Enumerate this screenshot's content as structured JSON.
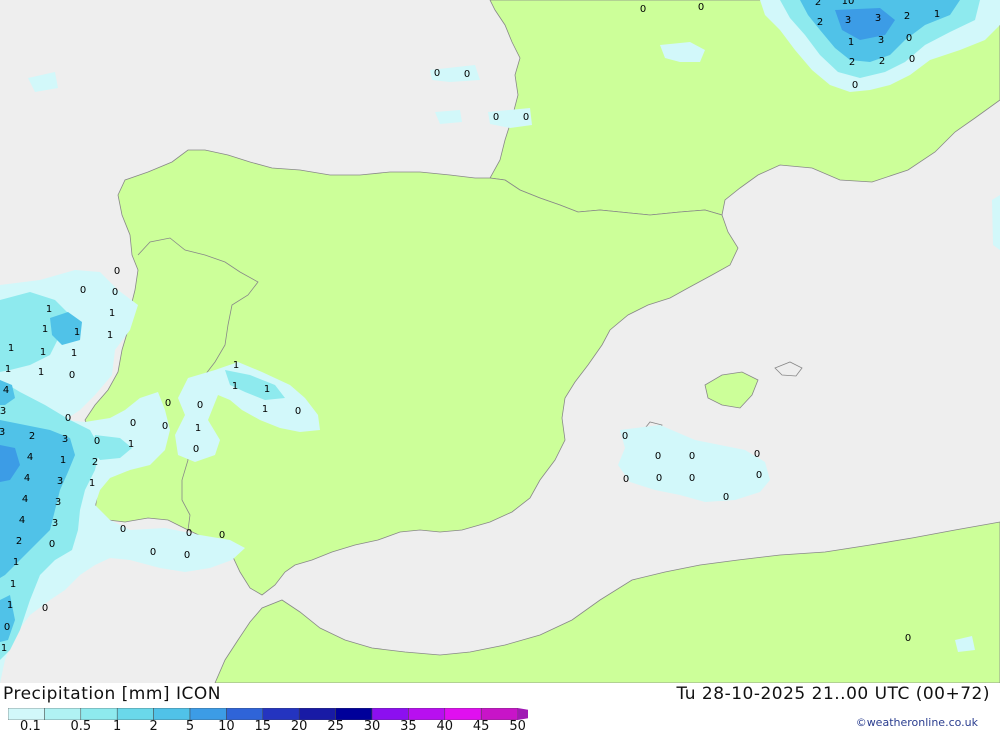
{
  "map": {
    "region": "Iberian Peninsula",
    "colors": {
      "sea": "#eeeeee",
      "land": "#ccff99",
      "border": "#888888"
    }
  },
  "legend": {
    "title": "Precipitation [mm]",
    "model": "ICON",
    "values": [
      "0.1",
      "0.5",
      "1",
      "2",
      "5",
      "10",
      "15",
      "20",
      "25",
      "30",
      "35",
      "40",
      "45",
      "50"
    ],
    "colors": [
      "#d2f8fa",
      "#b0f2f3",
      "#8eeaee",
      "#6ad8ea",
      "#50c2e8",
      "#3c9ce6",
      "#2f64d8",
      "#2434c0",
      "#181aa5",
      "#00009a",
      "#8c0ff0",
      "#b80ff0",
      "#e00ff0",
      "#c814c8",
      "#a019b4"
    ]
  },
  "timestamp": "Tu 28-10-2025 21..00 UTC (00+72)",
  "credit": "©weatheronline.co.uk",
  "labels": [
    "0",
    "0",
    "2",
    "10",
    "2",
    "3",
    "3",
    "2",
    "1",
    "1",
    "3",
    "0",
    "2",
    "2",
    "0",
    "0",
    "0",
    "0",
    "0",
    "0",
    "0",
    "0",
    "0",
    "1",
    "1",
    "1",
    "1",
    "1",
    "1",
    "1",
    "1",
    "1",
    "1",
    "0",
    "4",
    "3",
    "0",
    "3",
    "2",
    "3",
    "0",
    "4",
    "1",
    "2",
    "1",
    "4",
    "3",
    "1",
    "4",
    "3",
    "4",
    "3",
    "2",
    "0",
    "1",
    "1",
    "1",
    "0",
    "0",
    "1",
    "1",
    "1",
    "1",
    "1",
    "0",
    "0",
    "0",
    "0",
    "0",
    "1",
    "0",
    "0",
    "0",
    "0",
    "0",
    "0",
    "0",
    "0",
    "0",
    "0",
    "0",
    "0",
    "0",
    "0",
    "0",
    "0"
  ]
}
